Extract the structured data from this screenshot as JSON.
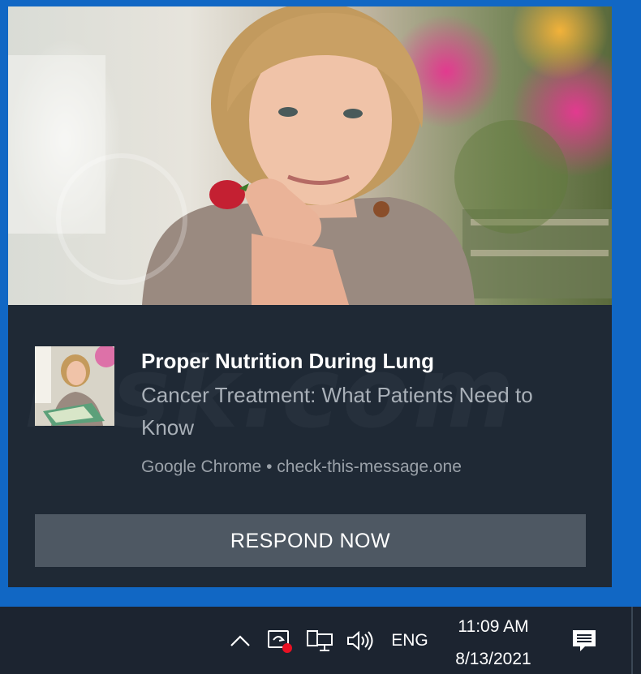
{
  "notification": {
    "title": "Proper Nutrition During Lung",
    "subtitle": "Cancer Treatment: What Patients Need to Know",
    "source": "Google Chrome • check-this-message.one",
    "button_label": "RESPOND NOW",
    "watermark": "risk.com"
  },
  "taskbar": {
    "icons": [
      "chevron-up-icon",
      "task-manager-icon",
      "network-icon",
      "volume-icon",
      "action-center-icon"
    ],
    "language": "ENG",
    "time": "11:09 AM",
    "date": "8/13/2021"
  },
  "colors": {
    "desktop_accent": "#1167c4",
    "toast_bg": "#1f2935",
    "button_bg": "#4e5863",
    "taskbar_bg": "#1c2430"
  }
}
